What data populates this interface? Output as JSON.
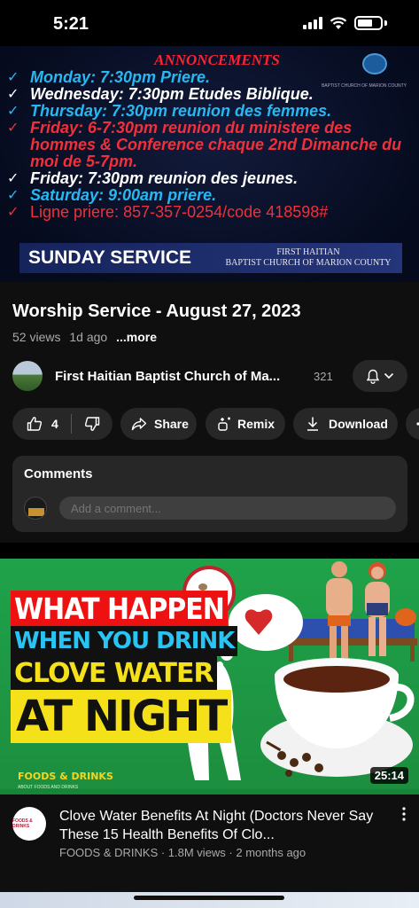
{
  "status_bar": {
    "time": "5:21"
  },
  "player": {
    "title": "ANNONCEMENTS",
    "logo_caption": "BAPTIST CHURCH OF MARION COUNTY",
    "lines": [
      {
        "check": "✓",
        "text": "Monday: 7:30pm Priere.",
        "color": "blue"
      },
      {
        "check": "✓",
        "text": "Wednesday: 7:30pm Etudes Biblique.",
        "color": "white"
      },
      {
        "check": "✓",
        "text": "Thursday: 7:30pm reunion des femmes.",
        "color": "blue"
      },
      {
        "check": "✓",
        "text": "Friday: 6-7:30pm reunion du ministere des hommes & Conference chaque 2nd Dimanche du moi de 5-7pm.",
        "color": "red"
      },
      {
        "check": "✓",
        "text": "Friday: 7:30pm reunion des jeunes.",
        "color": "white"
      },
      {
        "check": "✓",
        "text": "Saturday: 9:00am priere.",
        "color": "blue"
      },
      {
        "check": "✓",
        "text": "Ligne priere: 857-357-0254/code 418598#",
        "color": "red"
      }
    ],
    "banner_left": "SUNDAY SERVICE",
    "banner_right_1": "FIRST HAITIAN",
    "banner_right_2": "BAPTIST CHURCH OF MARION COUNTY"
  },
  "video": {
    "title": "Worship Service - August 27, 2023",
    "views": "52 views",
    "age": "1d ago",
    "more_label": "...more"
  },
  "channel": {
    "name": "First Haitian Baptist Church of Ma...",
    "subscribers": "321"
  },
  "actions": {
    "like_count": "4",
    "share_label": "Share",
    "remix_label": "Remix",
    "download_label": "Download"
  },
  "comments": {
    "title": "Comments",
    "placeholder": "Add a comment..."
  },
  "recommended": {
    "thumb_line1": "WHAT HAPPEN",
    "thumb_line2": "WHEN YOU DRINK",
    "thumb_line3": "CLOVE WATER",
    "thumb_line4": "AT NIGHT",
    "thumb_brand": "FOODS & DRINKS",
    "thumb_brand_sub": "ABOUT FOODS AND DRINKS",
    "duration": "25:14",
    "avatar_text": "FOODS & DRINKS",
    "title": "Clove Water Benefits At Night (Doctors Never Say These 15 Health Benefits Of Clo...",
    "meta": "FOODS & DRINKS · 1.8M views · 2 months ago"
  }
}
